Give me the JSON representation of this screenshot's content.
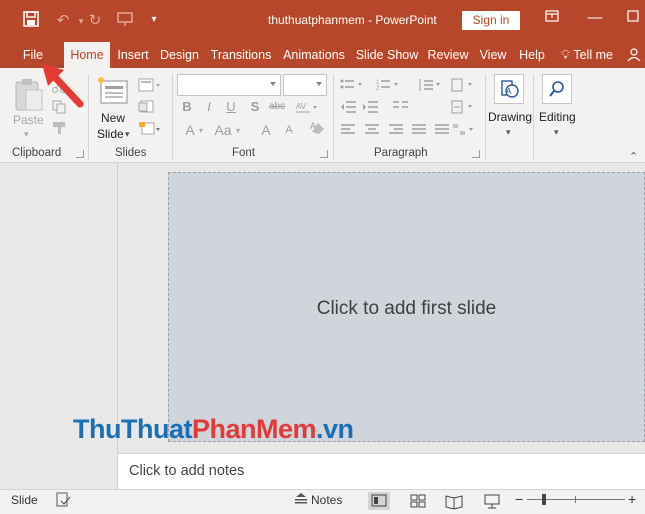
{
  "title_bar": {
    "document_title": "thuthuatphanmem  -  PowerPoint",
    "sign_in": "Sign in",
    "colors": {
      "brand": "#b7472a",
      "ribbon": "#f3f2f1"
    }
  },
  "tabs": [
    {
      "label": "File"
    },
    {
      "label": "Home",
      "active": true
    },
    {
      "label": "Insert"
    },
    {
      "label": "Design"
    },
    {
      "label": "Transitions"
    },
    {
      "label": "Animations"
    },
    {
      "label": "Slide Show"
    },
    {
      "label": "Review"
    },
    {
      "label": "View"
    },
    {
      "label": "Help"
    },
    {
      "label": "Tell me"
    }
  ],
  "ribbon": {
    "clipboard": {
      "paste": "Paste",
      "label": "Clipboard"
    },
    "slides": {
      "new_slide_1": "New",
      "new_slide_2": "Slide",
      "label": "Slides"
    },
    "font": {
      "bold": "B",
      "italic": "I",
      "underline": "U",
      "shadow": "S",
      "strike": "abc",
      "font_color": "A",
      "grow": "A",
      "shrink": "A",
      "aa": "Aa",
      "label": "Font"
    },
    "paragraph": {
      "label": "Paragraph"
    },
    "drawing": {
      "label": "Drawing"
    },
    "editing": {
      "label": "Editing"
    }
  },
  "workspace": {
    "slide_prompt": "Click to add first slide",
    "notes_prompt": "Click to add notes"
  },
  "status_bar": {
    "slide": "Slide",
    "notes": "Notes",
    "zoom_minus": "−",
    "zoom_plus": "+"
  },
  "watermark": {
    "part1": "ThuThuat",
    "part2": "PhanMem",
    "part3": ".vn"
  }
}
